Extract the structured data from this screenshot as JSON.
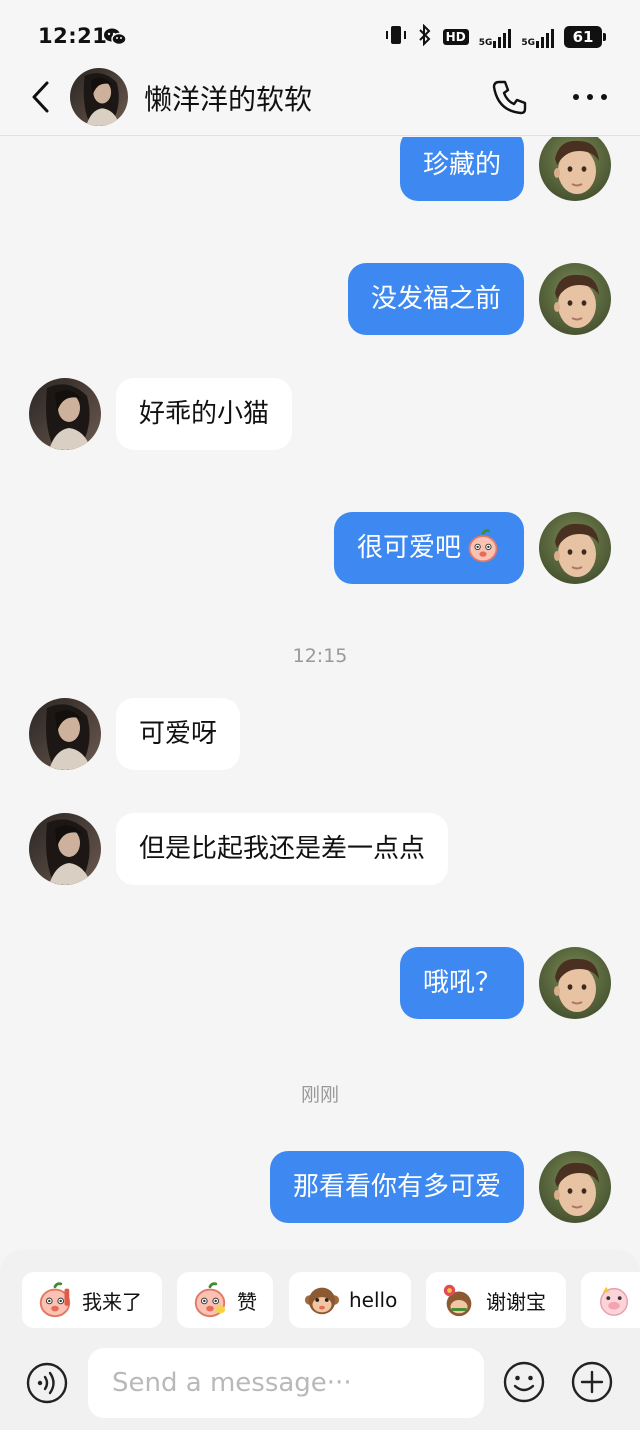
{
  "status_bar": {
    "time": "12:21",
    "hd": "HD",
    "net1": "5G",
    "net2": "5G",
    "battery": "61"
  },
  "header": {
    "contact_name": "懒洋洋的软软"
  },
  "messages": [
    {
      "side": "out",
      "text": "珍藏的"
    },
    {
      "side": "out",
      "text": "没发福之前"
    },
    {
      "side": "in",
      "text": "好乖的小猫"
    },
    {
      "side": "out",
      "text": "很可爱吧",
      "emoji": "peach-face"
    },
    {
      "timestamp": "12:15"
    },
    {
      "side": "in",
      "text": "可爱呀"
    },
    {
      "side": "in",
      "text": "但是比起我还是差一点点"
    },
    {
      "side": "out",
      "text": "哦吼？"
    },
    {
      "timestamp": "刚刚"
    },
    {
      "side": "out",
      "text": "那看看你有多可爱"
    }
  ],
  "stickers": [
    {
      "label": "我来了",
      "icon": "peach-sticker-wave"
    },
    {
      "label": "赞",
      "icon": "peach-sticker-thumb"
    },
    {
      "label": "hello",
      "icon": "monkey-sticker"
    },
    {
      "label": "谢谢宝",
      "icon": "flower-sticker"
    },
    {
      "label": "",
      "icon": "pig-sticker"
    }
  ],
  "composer": {
    "placeholder": "Send a message···"
  },
  "colors": {
    "outgoing_bubble": "#3e89f1",
    "incoming_bubble": "#ffffff",
    "background": "#f5f5f5"
  }
}
